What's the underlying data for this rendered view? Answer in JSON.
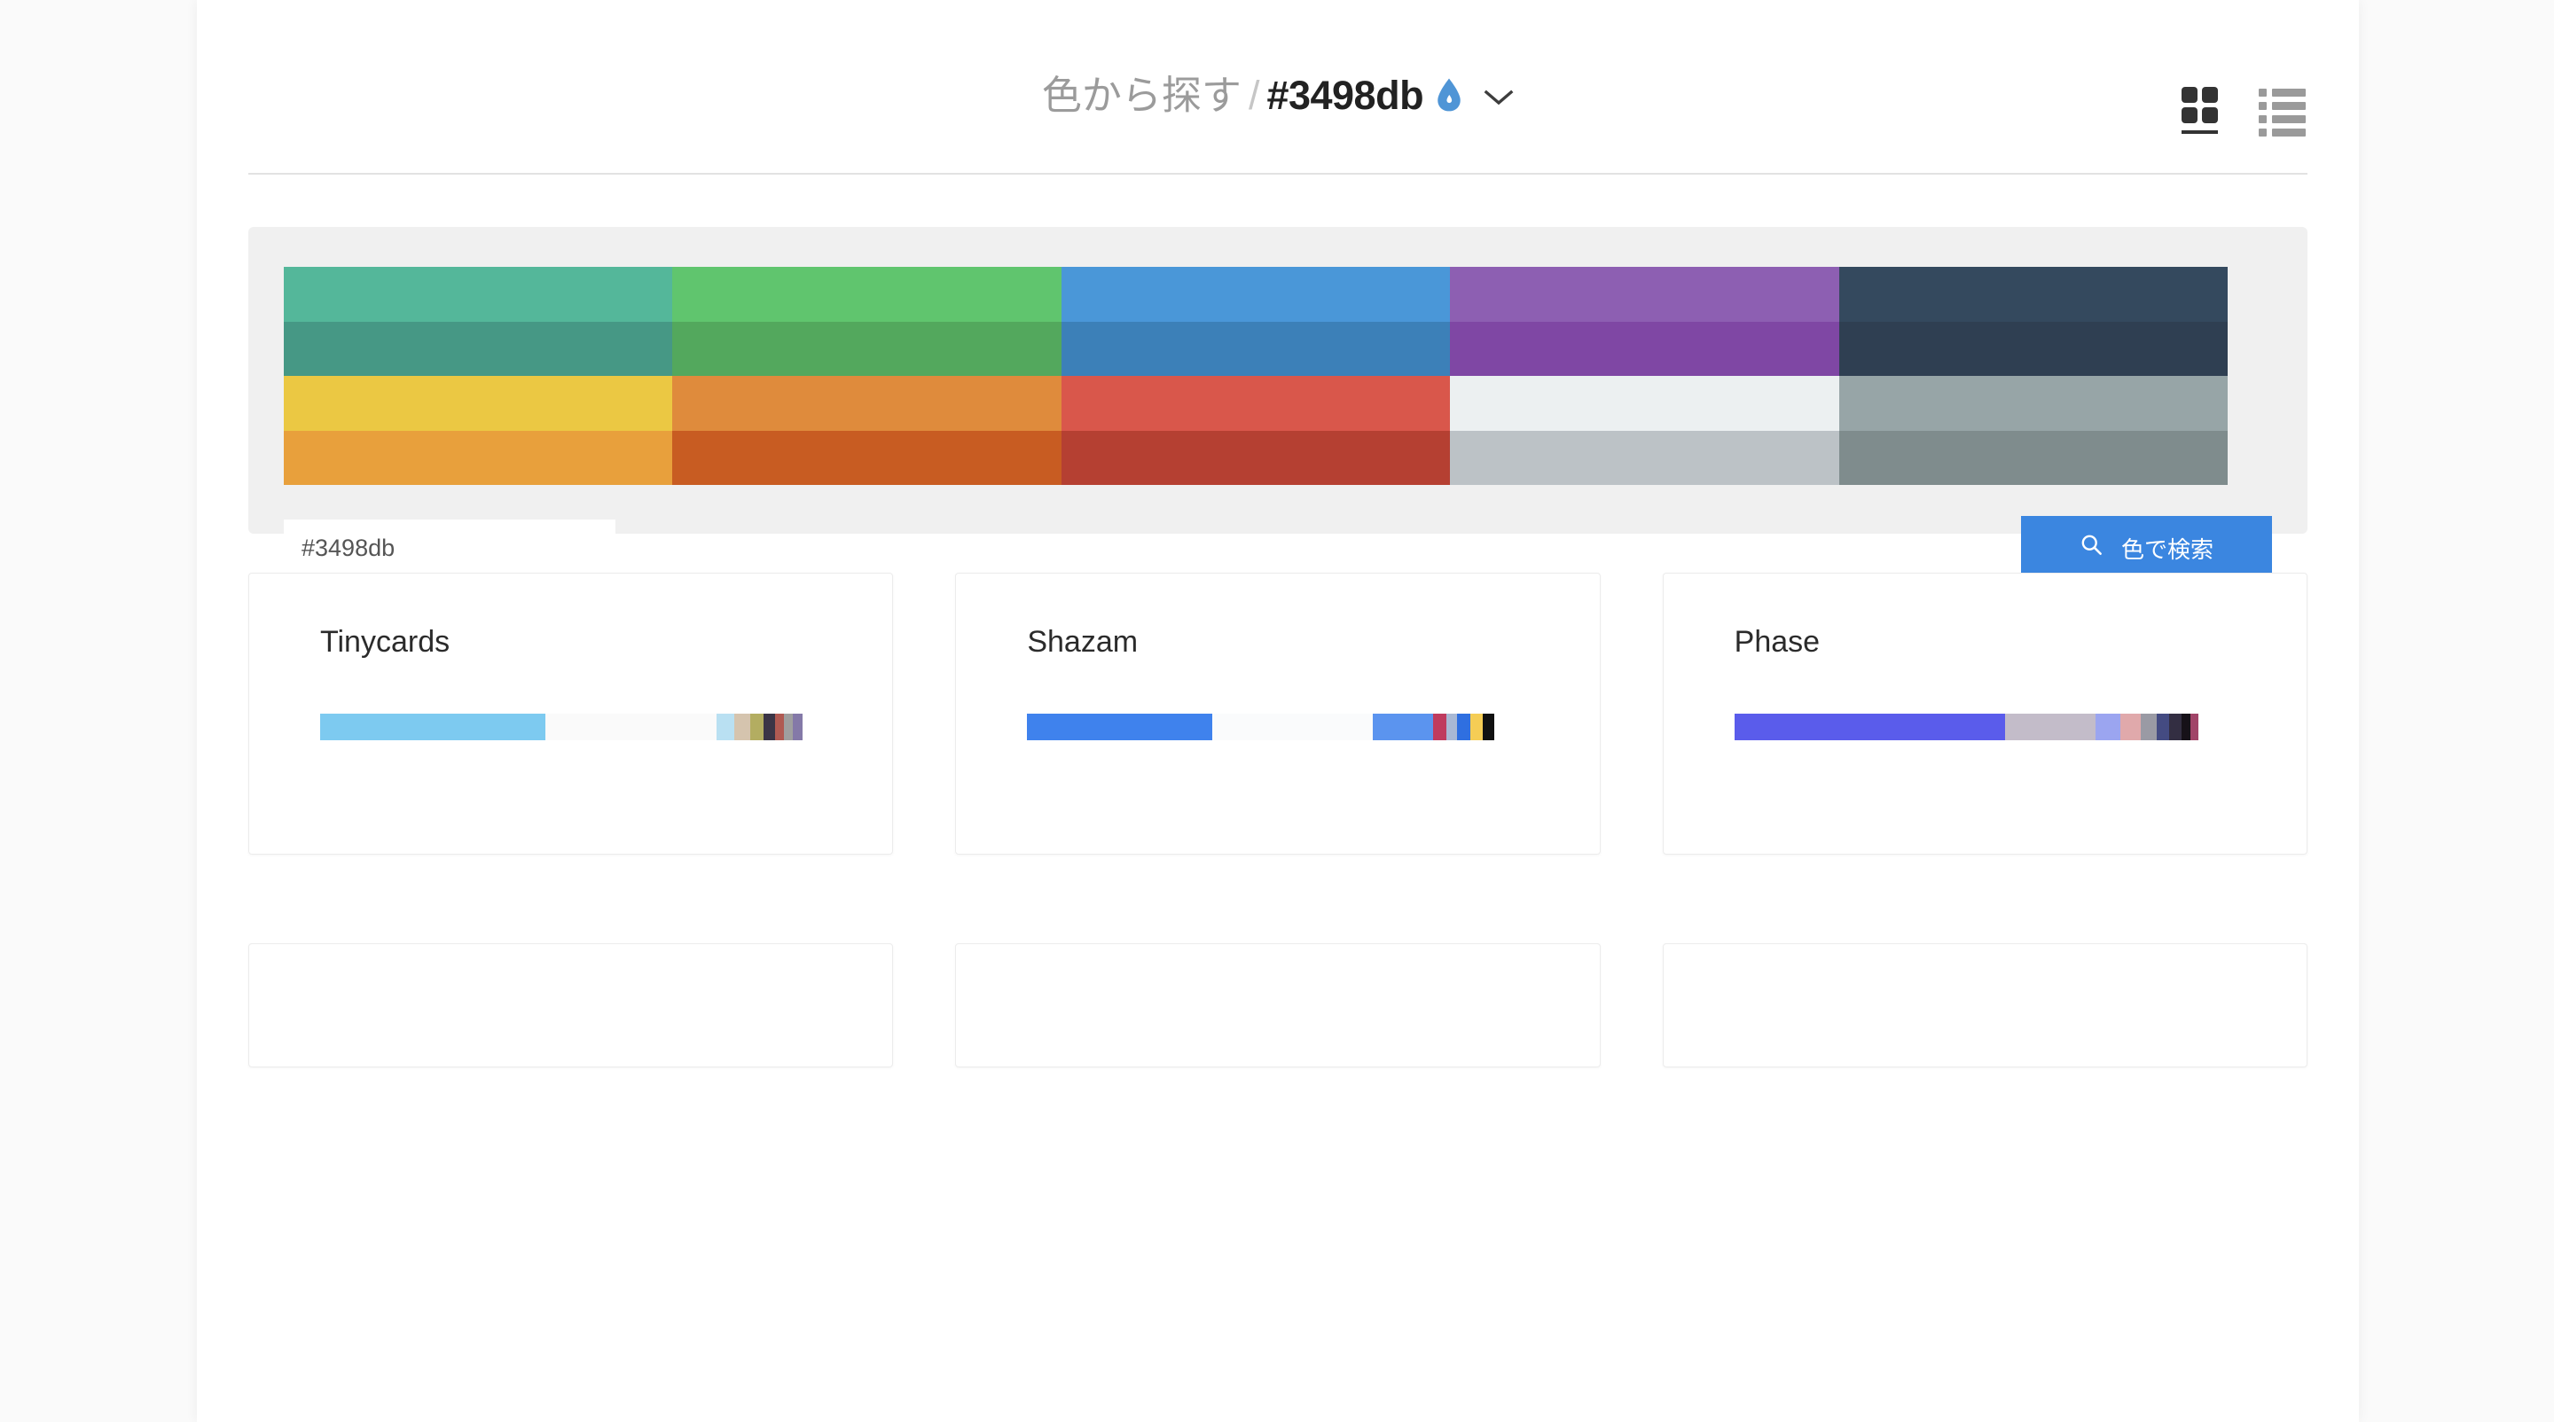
{
  "header": {
    "title_prefix": "色から探す",
    "title_separator": "/",
    "title_hex": "#3498db",
    "drop_icon": "💧",
    "chevron_icon": "chevron-down",
    "view_grid_label": "グリッド表示",
    "view_list_label": "リスト表示",
    "active_view": "grid"
  },
  "search": {
    "hex_value": "#3498db",
    "hex_placeholder": "#3498db",
    "preview_color": "#4a90d0",
    "button_label": "色で検索",
    "button_color": "#3b86e0",
    "search_icon": "search-icon"
  },
  "palette": {
    "rows": 4,
    "columns": 5,
    "swatches": [
      "#54b79a",
      "#60c56e",
      "#4a97d8",
      "#8d5fb2",
      "#34495e",
      "#469885",
      "#53a85d",
      "#3c80b8",
      "#7f47a4",
      "#2f3f52",
      "#ebc843",
      "#df8b3c",
      "#d9574b",
      "#ecf0f1",
      "#97a5a7",
      "#e8a03c",
      "#c85c22",
      "#b54032",
      "#bcc2c6",
      "#7f8c8d"
    ]
  },
  "cards": [
    {
      "name": "Tinycards",
      "bar": [
        {
          "color": "#7dcaf0",
          "weight": 45
        },
        {
          "color": "#fafafa",
          "weight": 34
        },
        {
          "color": "#b9e0f2",
          "weight": 3.6
        },
        {
          "color": "#d5c4ae",
          "weight": 3.2
        },
        {
          "color": "#b3ad61",
          "weight": 2.6
        },
        {
          "color": "#3b3546",
          "weight": 2.4
        },
        {
          "color": "#b05a52",
          "weight": 1.7
        },
        {
          "color": "#9f9f9f",
          "weight": 1.8
        },
        {
          "color": "#8479a8",
          "weight": 2.0
        },
        {
          "color": "#ffffff",
          "weight": 3.7
        }
      ]
    },
    {
      "name": "Shazam",
      "bar": [
        {
          "color": "#3f82ed",
          "weight": 37
        },
        {
          "color": "#fafbfc",
          "weight": 32
        },
        {
          "color": "#5b94ef",
          "weight": 12
        },
        {
          "color": "#bf3b5e",
          "weight": 2.6
        },
        {
          "color": "#a8b8d4",
          "weight": 2.2
        },
        {
          "color": "#2f6fe0",
          "weight": 2.6
        },
        {
          "color": "#f5cd55",
          "weight": 2.4
        },
        {
          "color": "#111111",
          "weight": 2.4
        },
        {
          "color": "#ffffff",
          "weight": 6.8
        }
      ]
    },
    {
      "name": "Phase",
      "bar": [
        {
          "color": "#5a5ceb",
          "weight": 54
        },
        {
          "color": "#c3bcc9",
          "weight": 18
        },
        {
          "color": "#9ba5f0",
          "weight": 5
        },
        {
          "color": "#e0a9ab",
          "weight": 4
        },
        {
          "color": "#9a9aa4",
          "weight": 3.2
        },
        {
          "color": "#444b82",
          "weight": 2.6
        },
        {
          "color": "#332e42",
          "weight": 2.4
        },
        {
          "color": "#161118",
          "weight": 1.8
        },
        {
          "color": "#a14468",
          "weight": 1.6
        },
        {
          "color": "#ffffff",
          "weight": 7.4
        }
      ]
    }
  ],
  "cards_next_row": [
    {
      "name": ""
    },
    {
      "name": ""
    },
    {
      "name": ""
    }
  ]
}
